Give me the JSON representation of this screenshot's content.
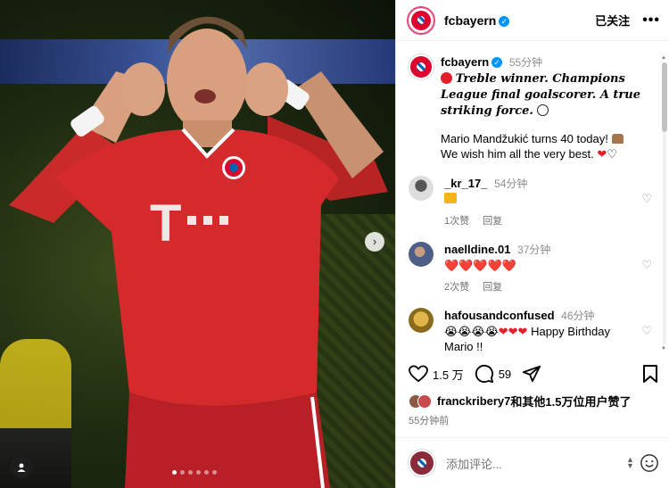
{
  "post": {
    "username": "fcbayern",
    "follow_label": "已关注",
    "more_label": "•••",
    "carousel_next": "›",
    "carousel_count": 6,
    "carousel_active": 0
  },
  "caption": {
    "username": "fcbayern",
    "time": "55分钟",
    "highlight": "Treble winner. Champions League final goalscorer. A true striking force.",
    "text": "Mario Mandžukić turns 40 today!",
    "text2": "We wish him all the very best."
  },
  "comments": [
    {
      "username": "_kr_17_",
      "time": "54分钟",
      "text": "",
      "likes": "1次赞",
      "reply": "回复",
      "avatar_color": "#d9d9d9"
    },
    {
      "username": "naelldine.01",
      "time": "37分钟",
      "text": "❤️❤️❤️❤️❤️",
      "likes": "2次赞",
      "reply": "回复",
      "avatar_color": "#4d5f86"
    },
    {
      "username": "hafousandconfused",
      "time": "46分钟",
      "text_prefix": "",
      "text": "Happy Birthday Mario !!",
      "avatar_color": "#c49a2c"
    }
  ],
  "actions": {
    "like_count": "1.5 万",
    "comment_count": "59"
  },
  "liked_by": {
    "user": "franckribery7",
    "suffix": "和其他1.5万位用户赞了"
  },
  "posted_time": "55分钟前",
  "add_comment": {
    "placeholder": "添加评论..."
  },
  "colors": {
    "bayern_red": "#dc052d",
    "verified_blue": "#0095f6",
    "heart_red": "#e0202b"
  }
}
